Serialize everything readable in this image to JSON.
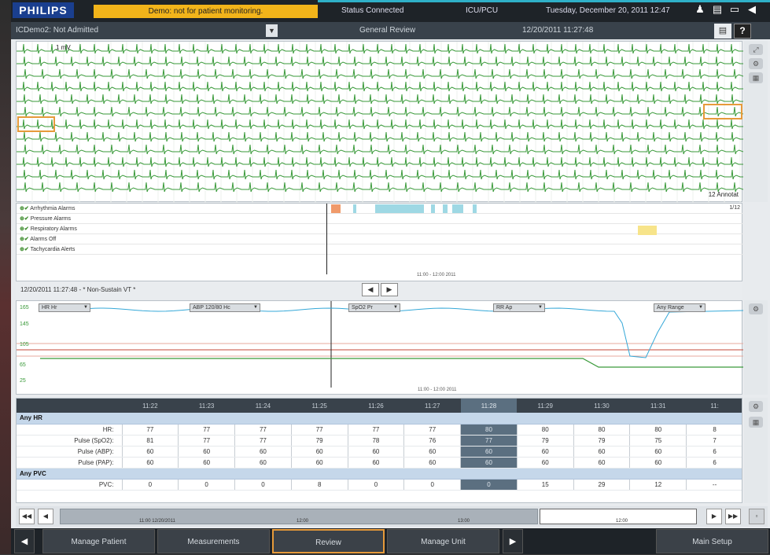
{
  "topbar": {
    "brand": "PHILIPS",
    "demo_notice": "Demo: not for patient monitoring.",
    "status": "Status Connected",
    "unit": "ICU/PCU",
    "datetime": "Tuesday, December 20, 2011 12:47"
  },
  "patientbar": {
    "patient": "ICDemo2: Not Admitted",
    "view_title": "General Review",
    "view_time": "12/20/2011 11:27:48",
    "help_label": "?"
  },
  "ecg": {
    "scale_label": "1 mV",
    "annotation": "12 Annotat"
  },
  "alarms": {
    "rows": [
      "Arrhythmia Alarms",
      "Pressure Alarms",
      "Respiratory Alarms",
      "Alarms Off",
      "Tachycardia Alerts"
    ],
    "count": "1/12",
    "time_label": "11:00 - 12:00 2011"
  },
  "event": {
    "label": "12/20/2011 11:27:48 - * Non-Sustain VT *"
  },
  "trends": {
    "left_ticks": [
      "165",
      "145",
      "105",
      "65",
      "25"
    ],
    "dropdowns": [
      "HR Hr",
      "ABP 120/80 Hc",
      "SpO2 Pr",
      "RR Ap",
      "Any Range"
    ],
    "time_label": "11:00 - 12:00 2011"
  },
  "table": {
    "times": [
      "11:22",
      "11:23",
      "11:24",
      "11:25",
      "11:26",
      "11:27",
      "11:28",
      "11:29",
      "11:30",
      "11:31",
      "11:"
    ],
    "current_index": 6,
    "groups": [
      {
        "title": "Any HR",
        "rows": [
          {
            "label": "HR:",
            "values": [
              "77",
              "77",
              "77",
              "77",
              "77",
              "77",
              "80",
              "80",
              "80",
              "80",
              "8"
            ]
          },
          {
            "label": "Pulse (SpO2):",
            "values": [
              "81",
              "77",
              "77",
              "79",
              "78",
              "76",
              "77",
              "79",
              "79",
              "75",
              "7"
            ]
          },
          {
            "label": "Pulse (ABP):",
            "values": [
              "60",
              "60",
              "60",
              "60",
              "60",
              "60",
              "60",
              "60",
              "60",
              "60",
              "6"
            ]
          },
          {
            "label": "Pulse (PAP):",
            "values": [
              "60",
              "60",
              "60",
              "60",
              "60",
              "60",
              "60",
              "60",
              "60",
              "60",
              "6"
            ]
          }
        ]
      },
      {
        "title": "Any PVC",
        "rows": [
          {
            "label": "PVC:",
            "values": [
              "0",
              "0",
              "0",
              "8",
              "0",
              "0",
              "0",
              "15",
              "29",
              "12",
              "--"
            ]
          }
        ]
      }
    ]
  },
  "timeline": {
    "dates": [
      "11:00 12/20/2011",
      "12:00",
      "13:00",
      "12:00"
    ]
  },
  "bottomnav": {
    "manage_patient": "Manage Patient",
    "measurements": "Measurements",
    "review": "Review",
    "manage_unit": "Manage Unit",
    "main_setup": "Main Setup"
  },
  "colors": {
    "ecg": "#3a9a3a",
    "spo2": "#35a8d8",
    "abp": "#c44a3a",
    "accent": "#e69a3a",
    "demo": "#f2b41a"
  }
}
